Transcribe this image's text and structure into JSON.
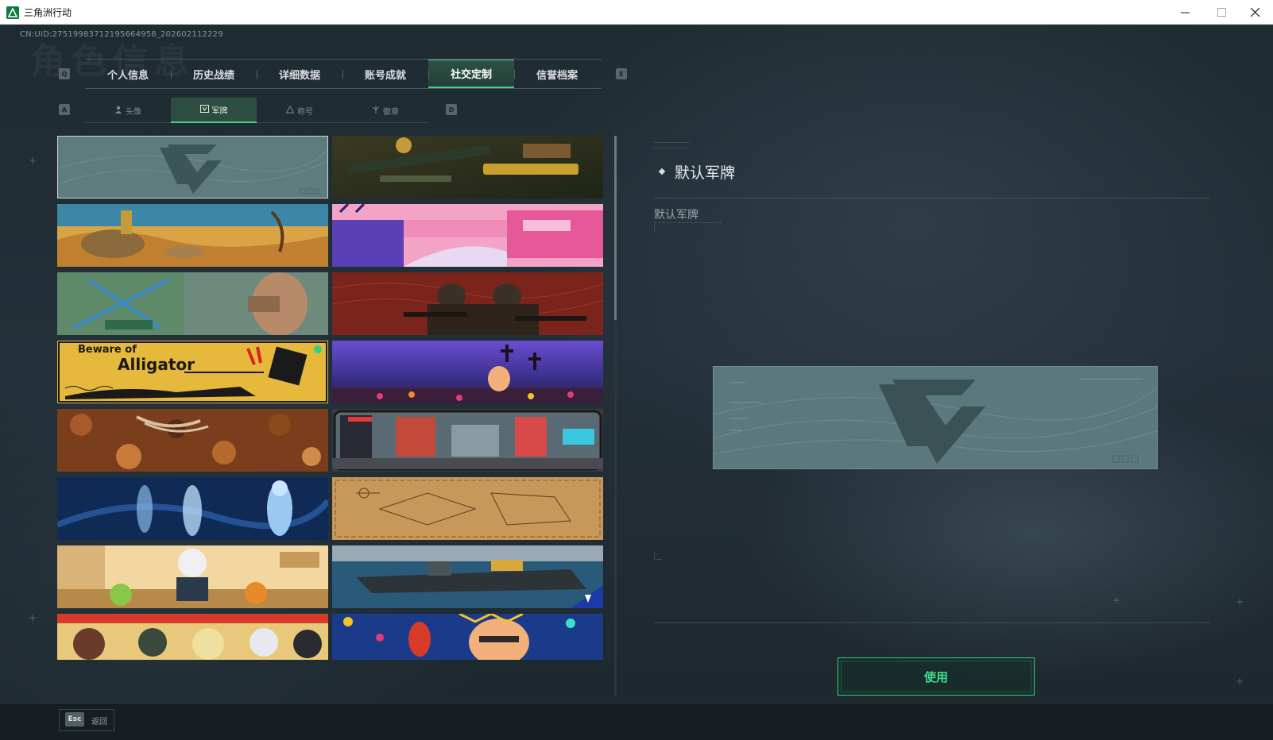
{
  "window": {
    "title": "三角洲行动",
    "controls": {
      "minimize": "—",
      "maximize": "☐",
      "close": "✕"
    }
  },
  "header": {
    "uid": "CN:UID:2751998371219566495​8_202602112229",
    "watermark": "角色信息"
  },
  "main_tabs": {
    "left_key": "Q",
    "right_key": "E",
    "items": [
      {
        "label": "个人信息"
      },
      {
        "label": "历史战绩"
      },
      {
        "label": "详细数据"
      },
      {
        "label": "账号成就"
      },
      {
        "label": "社交定制",
        "active": true
      },
      {
        "label": "信誉档案"
      }
    ]
  },
  "sub_tabs": {
    "left_key": "A",
    "right_key": "D",
    "items": [
      {
        "label": "头像",
        "icon": "person-icon"
      },
      {
        "label": "军牌",
        "icon": "badge-icon",
        "active": true
      },
      {
        "label": "称号",
        "icon": "triangle-icon"
      },
      {
        "label": "徽章",
        "icon": "emblem-icon"
      }
    ]
  },
  "grid": {
    "cards": [
      {
        "name": "default-nameplate",
        "selected": true
      },
      {
        "name": "weapons-on-table"
      },
      {
        "name": "desert-dali"
      },
      {
        "name": "pink-sunset-city"
      },
      {
        "name": "girl-with-crossbow"
      },
      {
        "name": "soldiers-red"
      },
      {
        "name": "beware-of-alligator",
        "text_line1": "Beware of",
        "text_line2": "Alligator"
      },
      {
        "name": "day-of-dead-cemetery"
      },
      {
        "name": "autumn-leaves"
      },
      {
        "name": "pixel-city-train"
      },
      {
        "name": "xray-skeletons"
      },
      {
        "name": "sepia-sketch"
      },
      {
        "name": "cartoon-kitchen"
      },
      {
        "name": "aircraft-carrier"
      },
      {
        "name": "cartoon-squad"
      },
      {
        "name": "festive-party"
      }
    ]
  },
  "detail": {
    "title": "默认军牌",
    "subtitle": "默认军牌",
    "use_button": "使用"
  },
  "footer": {
    "esc_key": "Esc",
    "back_label": "返回"
  },
  "colors": {
    "accent": "#3fd38c",
    "background": "#1f2b32",
    "preview": "#5b797c"
  }
}
